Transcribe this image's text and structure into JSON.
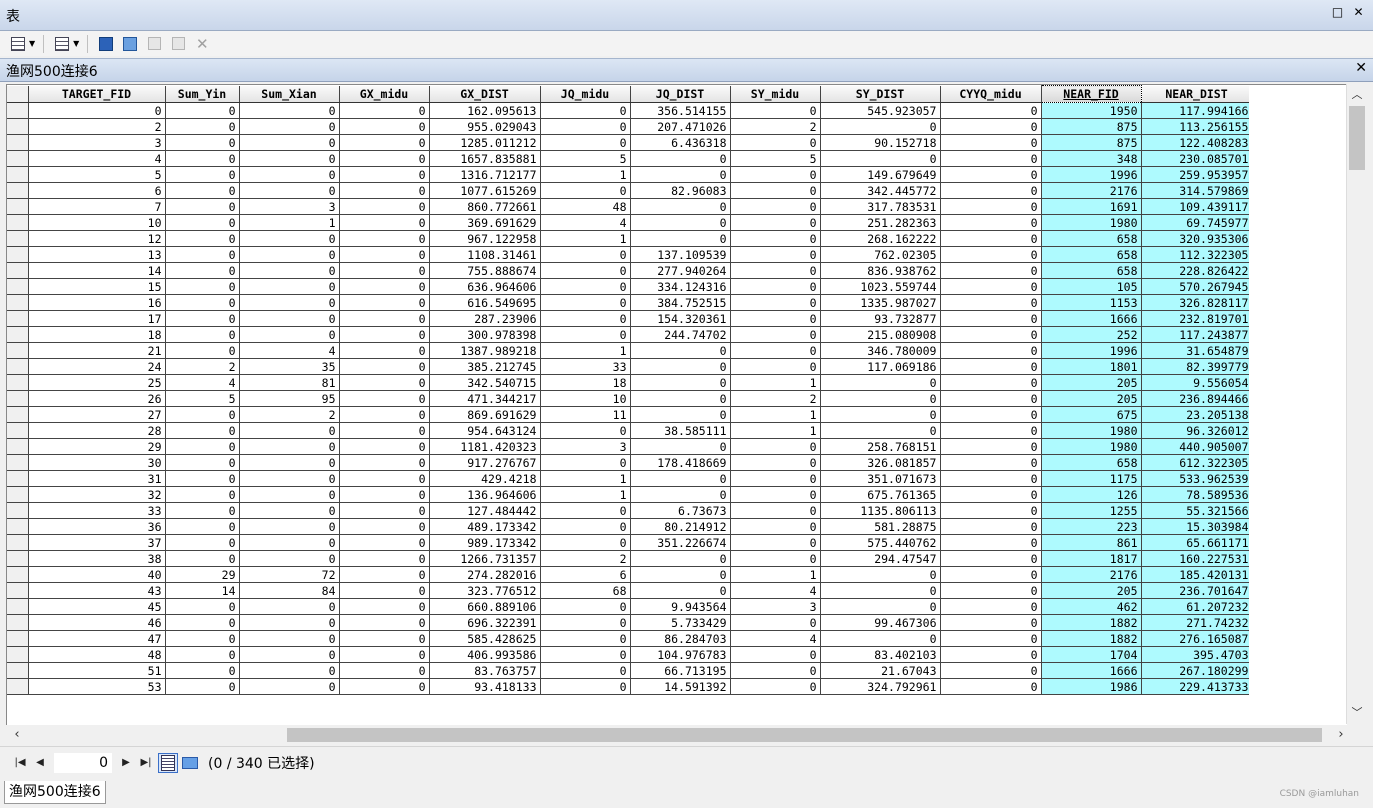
{
  "window": {
    "title": "表"
  },
  "table_tab": {
    "title": "渔网500连接6"
  },
  "columns": [
    "TARGET_FID",
    "Sum_Yin",
    "Sum_Xian",
    "GX_midu",
    "GX_DIST",
    "JQ_midu",
    "JQ_DIST",
    "SY_midu",
    "SY_DIST",
    "CYYQ_midu",
    "NEAR_FID",
    "NEAR_DIST"
  ],
  "highlight_color": "#aefafe",
  "rows": [
    [
      "0",
      "0",
      "0",
      "0",
      "162.095613",
      "0",
      "356.514155",
      "0",
      "545.923057",
      "0",
      "1950",
      "117.994166"
    ],
    [
      "2",
      "0",
      "0",
      "0",
      "955.029043",
      "0",
      "207.471026",
      "2",
      "0",
      "0",
      "875",
      "113.256155"
    ],
    [
      "3",
      "0",
      "0",
      "0",
      "1285.011212",
      "0",
      "6.436318",
      "0",
      "90.152718",
      "0",
      "875",
      "122.408283"
    ],
    [
      "4",
      "0",
      "0",
      "0",
      "1657.835881",
      "5",
      "0",
      "5",
      "0",
      "0",
      "348",
      "230.085701"
    ],
    [
      "5",
      "0",
      "0",
      "0",
      "1316.712177",
      "1",
      "0",
      "0",
      "149.679649",
      "0",
      "1996",
      "259.953957"
    ],
    [
      "6",
      "0",
      "0",
      "0",
      "1077.615269",
      "0",
      "82.96083",
      "0",
      "342.445772",
      "0",
      "2176",
      "314.579869"
    ],
    [
      "7",
      "0",
      "3",
      "0",
      "860.772661",
      "48",
      "0",
      "0",
      "317.783531",
      "0",
      "1691",
      "109.439117"
    ],
    [
      "10",
      "0",
      "1",
      "0",
      "369.691629",
      "4",
      "0",
      "0",
      "251.282363",
      "0",
      "1980",
      "69.745977"
    ],
    [
      "12",
      "0",
      "0",
      "0",
      "967.122958",
      "1",
      "0",
      "0",
      "268.162222",
      "0",
      "658",
      "320.935306"
    ],
    [
      "13",
      "0",
      "0",
      "0",
      "1108.31461",
      "0",
      "137.109539",
      "0",
      "762.02305",
      "0",
      "658",
      "112.322305"
    ],
    [
      "14",
      "0",
      "0",
      "0",
      "755.888674",
      "0",
      "277.940264",
      "0",
      "836.938762",
      "0",
      "658",
      "228.826422"
    ],
    [
      "15",
      "0",
      "0",
      "0",
      "636.964606",
      "0",
      "334.124316",
      "0",
      "1023.559744",
      "0",
      "105",
      "570.267945"
    ],
    [
      "16",
      "0",
      "0",
      "0",
      "616.549695",
      "0",
      "384.752515",
      "0",
      "1335.987027",
      "0",
      "1153",
      "326.828117"
    ],
    [
      "17",
      "0",
      "0",
      "0",
      "287.23906",
      "0",
      "154.320361",
      "0",
      "93.732877",
      "0",
      "1666",
      "232.819701"
    ],
    [
      "18",
      "0",
      "0",
      "0",
      "300.978398",
      "0",
      "244.74702",
      "0",
      "215.080908",
      "0",
      "252",
      "117.243877"
    ],
    [
      "21",
      "0",
      "4",
      "0",
      "1387.989218",
      "1",
      "0",
      "0",
      "346.780009",
      "0",
      "1996",
      "31.654879"
    ],
    [
      "24",
      "2",
      "35",
      "0",
      "385.212745",
      "33",
      "0",
      "0",
      "117.069186",
      "0",
      "1801",
      "82.399779"
    ],
    [
      "25",
      "4",
      "81",
      "0",
      "342.540715",
      "18",
      "0",
      "1",
      "0",
      "0",
      "205",
      "9.556054"
    ],
    [
      "26",
      "5",
      "95",
      "0",
      "471.344217",
      "10",
      "0",
      "2",
      "0",
      "0",
      "205",
      "236.894466"
    ],
    [
      "27",
      "0",
      "2",
      "0",
      "869.691629",
      "11",
      "0",
      "1",
      "0",
      "0",
      "675",
      "23.205138"
    ],
    [
      "28",
      "0",
      "0",
      "0",
      "954.643124",
      "0",
      "38.585111",
      "1",
      "0",
      "0",
      "1980",
      "96.326012"
    ],
    [
      "29",
      "0",
      "0",
      "0",
      "1181.420323",
      "3",
      "0",
      "0",
      "258.768151",
      "0",
      "1980",
      "440.905007"
    ],
    [
      "30",
      "0",
      "0",
      "0",
      "917.276767",
      "0",
      "178.418669",
      "0",
      "326.081857",
      "0",
      "658",
      "612.322305"
    ],
    [
      "31",
      "0",
      "0",
      "0",
      "429.4218",
      "1",
      "0",
      "0",
      "351.071673",
      "0",
      "1175",
      "533.962539"
    ],
    [
      "32",
      "0",
      "0",
      "0",
      "136.964606",
      "1",
      "0",
      "0",
      "675.761365",
      "0",
      "126",
      "78.589536"
    ],
    [
      "33",
      "0",
      "0",
      "0",
      "127.484442",
      "0",
      "6.73673",
      "0",
      "1135.806113",
      "0",
      "1255",
      "55.321566"
    ],
    [
      "36",
      "0",
      "0",
      "0",
      "489.173342",
      "0",
      "80.214912",
      "0",
      "581.28875",
      "0",
      "223",
      "15.303984"
    ],
    [
      "37",
      "0",
      "0",
      "0",
      "989.173342",
      "0",
      "351.226674",
      "0",
      "575.440762",
      "0",
      "861",
      "65.661171"
    ],
    [
      "38",
      "0",
      "0",
      "0",
      "1266.731357",
      "2",
      "0",
      "0",
      "294.47547",
      "0",
      "1817",
      "160.227531"
    ],
    [
      "40",
      "29",
      "72",
      "0",
      "274.282016",
      "6",
      "0",
      "1",
      "0",
      "0",
      "2176",
      "185.420131"
    ],
    [
      "43",
      "14",
      "84",
      "0",
      "323.776512",
      "68",
      "0",
      "4",
      "0",
      "0",
      "205",
      "236.701647"
    ],
    [
      "45",
      "0",
      "0",
      "0",
      "660.889106",
      "0",
      "9.943564",
      "3",
      "0",
      "0",
      "462",
      "61.207232"
    ],
    [
      "46",
      "0",
      "0",
      "0",
      "696.322391",
      "0",
      "5.733429",
      "0",
      "99.467306",
      "0",
      "1882",
      "271.74232"
    ],
    [
      "47",
      "0",
      "0",
      "0",
      "585.428625",
      "0",
      "86.284703",
      "4",
      "0",
      "0",
      "1882",
      "276.165087"
    ],
    [
      "48",
      "0",
      "0",
      "0",
      "406.993586",
      "0",
      "104.976783",
      "0",
      "83.402103",
      "0",
      "1704",
      "395.4703"
    ],
    [
      "51",
      "0",
      "0",
      "0",
      "83.763757",
      "0",
      "66.713195",
      "0",
      "21.67043",
      "0",
      "1666",
      "267.180299"
    ],
    [
      "53",
      "0",
      "0",
      "0",
      "93.418133",
      "0",
      "14.591392",
      "0",
      "324.792961",
      "0",
      "1986",
      "229.413733"
    ]
  ],
  "navigation": {
    "record_value": "0",
    "status": "(0 / 340 已选择)"
  },
  "bottom_tab": {
    "label": "渔网500连接6"
  },
  "watermark": "CSDN @iamluhan"
}
